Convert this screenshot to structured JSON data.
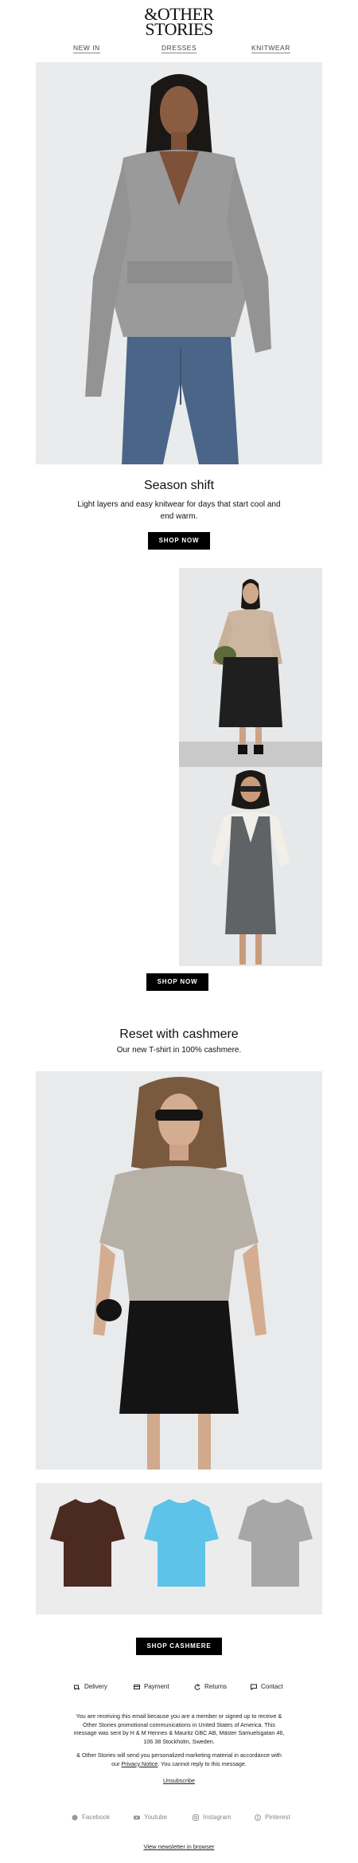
{
  "header": {
    "logo_line1": "&OTHER",
    "logo_line2": "STORIES",
    "nav": [
      {
        "label": "NEW IN"
      },
      {
        "label": "DRESSES"
      },
      {
        "label": "KNITWEAR"
      }
    ]
  },
  "section1": {
    "title": "Season shift",
    "body": "Light layers and easy knitwear for days that start cool and end warm.",
    "button": "SHOP NOW"
  },
  "section2": {
    "button": "SHOP NOW"
  },
  "section3": {
    "title": "Reset with cashmere",
    "body": "Our new T-shirt in 100% cashmere.",
    "button": "SHOP CASHMERE",
    "tees": [
      {
        "color": "#4a2a22"
      },
      {
        "color": "#5ec3e8"
      },
      {
        "color": "#a7a7a7"
      }
    ]
  },
  "footer": {
    "links": [
      {
        "label": "Delivery",
        "icon": "delivery-icon"
      },
      {
        "label": "Payment",
        "icon": "card-icon"
      },
      {
        "label": "Returns",
        "icon": "returns-icon"
      },
      {
        "label": "Contact",
        "icon": "chat-icon"
      }
    ],
    "legal1": "You are receiving this email because you are a member or signed up to receive & Other Stories promotional communications in United States of America. This message was sent by H & M Hennes & Mauritz GBC AB, Mäster Samuelsgatan 46, 106 38 Stockholm, Sweden.",
    "legal2_pre": "& Other Stories will send you personalized marketing material in accordance with our ",
    "privacy_link": "Privacy Notice",
    "legal2_post": ". You cannot reply to this message.",
    "unsubscribe": "Unsubscribe",
    "social": [
      {
        "label": "Facebook",
        "icon": "facebook-icon"
      },
      {
        "label": "Youtube",
        "icon": "youtube-icon"
      },
      {
        "label": "Instagram",
        "icon": "instagram-icon"
      },
      {
        "label": "Pinterest",
        "icon": "pinterest-icon"
      }
    ],
    "browser_link": "View newsletter in browser"
  }
}
